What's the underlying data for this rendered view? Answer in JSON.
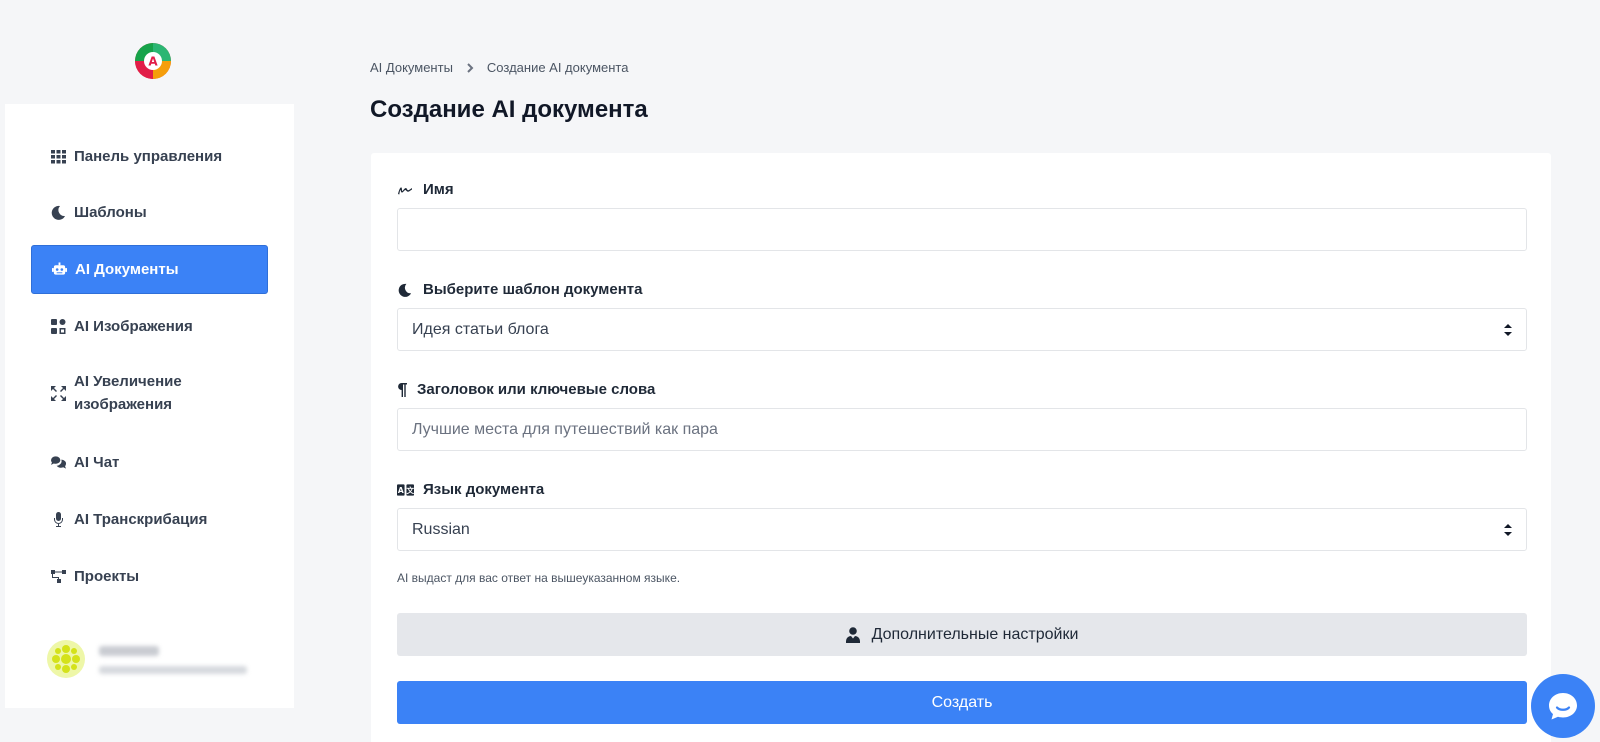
{
  "breadcrumb": {
    "root": "AI Документы",
    "current": "Создание AI документа"
  },
  "page": {
    "title": "Создание AI документа"
  },
  "sidebar": {
    "items": [
      {
        "label": "Панель управления",
        "icon": "grid-icon"
      },
      {
        "label": "Шаблоны",
        "icon": "moon-icon"
      },
      {
        "label": "AI Документы",
        "icon": "robot-icon",
        "active": true
      },
      {
        "label": "AI Изображения",
        "icon": "image-grid-icon"
      },
      {
        "label": "AI Увеличение изображения",
        "icon": "expand-icon"
      },
      {
        "label": "AI Чат",
        "icon": "chat-icon"
      },
      {
        "label": "AI Транскрибация",
        "icon": "microphone-icon"
      },
      {
        "label": "Проекты",
        "icon": "project-tree-icon"
      }
    ]
  },
  "form": {
    "name": {
      "label": "Имя",
      "value": "",
      "icon": "signature-icon"
    },
    "template": {
      "label": "Выберите шаблон документа",
      "value": "Идея статьи блога",
      "icon": "moon-icon"
    },
    "keywords": {
      "label": "Заголовок или ключевые слова",
      "placeholder": "Лучшие места для путешествий как пара",
      "icon": "paragraph-icon"
    },
    "language": {
      "label": "Язык документа",
      "value": "Russian",
      "icon": "language-icon",
      "hint": "AI выдаст для вас ответ на вышеуказанном языке."
    },
    "advanced_label": "Дополнительные настройки",
    "submit_label": "Создать"
  },
  "colors": {
    "accent": "#3b82f6",
    "background": "#f5f6f8",
    "secondary_button": "#e5e7eb"
  }
}
